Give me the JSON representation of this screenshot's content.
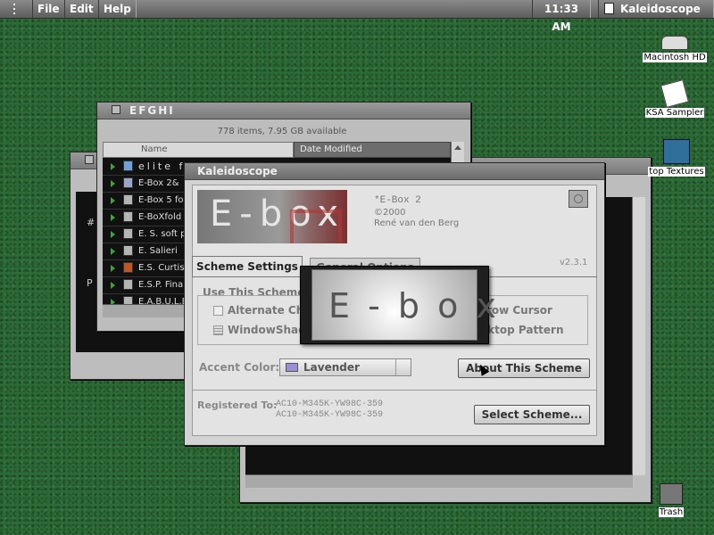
{
  "menubar": {
    "items": [
      "File",
      "Edit",
      "Help"
    ],
    "clock": "11:33 AM",
    "active_app": "Kaleidoscope"
  },
  "desktop_icons": [
    {
      "label": "Macintosh HD",
      "icon": "hard-drive-icon"
    },
    {
      "label": "KSA Sampler",
      "icon": "document-pen-icon"
    },
    {
      "label": "top Textures",
      "icon": "folder-icon"
    },
    {
      "label": "Trash",
      "icon": "trash-icon"
    }
  ],
  "finder": {
    "title": "EFGHI",
    "info": "778 items, 7.95 GB available",
    "col_name": "Name",
    "col_date": "Date Modified",
    "files": [
      "elite f",
      "E-Box 2&",
      "E-Box 5 fo",
      "E-BoXfold",
      "E. S. soft p",
      "E. Salieri",
      "E.S. Curtis",
      "E.S.P. Fina",
      "E.A.B.U.L.E"
    ]
  },
  "background_window": {
    "text_fragments": [
      "#",
      "P"
    ]
  },
  "kaleidoscope": {
    "title": "Kaleidoscope",
    "logo_text": "E-box",
    "scheme_name": "*E-Box 2",
    "copyright": "©2000",
    "author": "René van den Berg",
    "version": "v2.3.1",
    "tabs": [
      "Scheme Settings",
      "General Options"
    ],
    "group_label": "Use This Scheme's",
    "checkbox_1": "Alternate Che",
    "checkbox_2": "WindowShad",
    "right_option_1": "rrow Cursor",
    "right_option_2": "sktop Pattern",
    "accent_label": "Accent Color:",
    "accent_value": "Lavender",
    "about_button": "About This Scheme",
    "registered_label": "Registered To:",
    "registered_1": "AC10-M345K-YW98C-359",
    "registered_2": "AC10-M345K-YW98C-359",
    "select_button": "Select Scheme..."
  },
  "splash": {
    "text": "E - b o x"
  },
  "colors": {
    "desktop": "#2c6b36",
    "accent": "#9c8fd6",
    "logo_red": "#b03030"
  }
}
